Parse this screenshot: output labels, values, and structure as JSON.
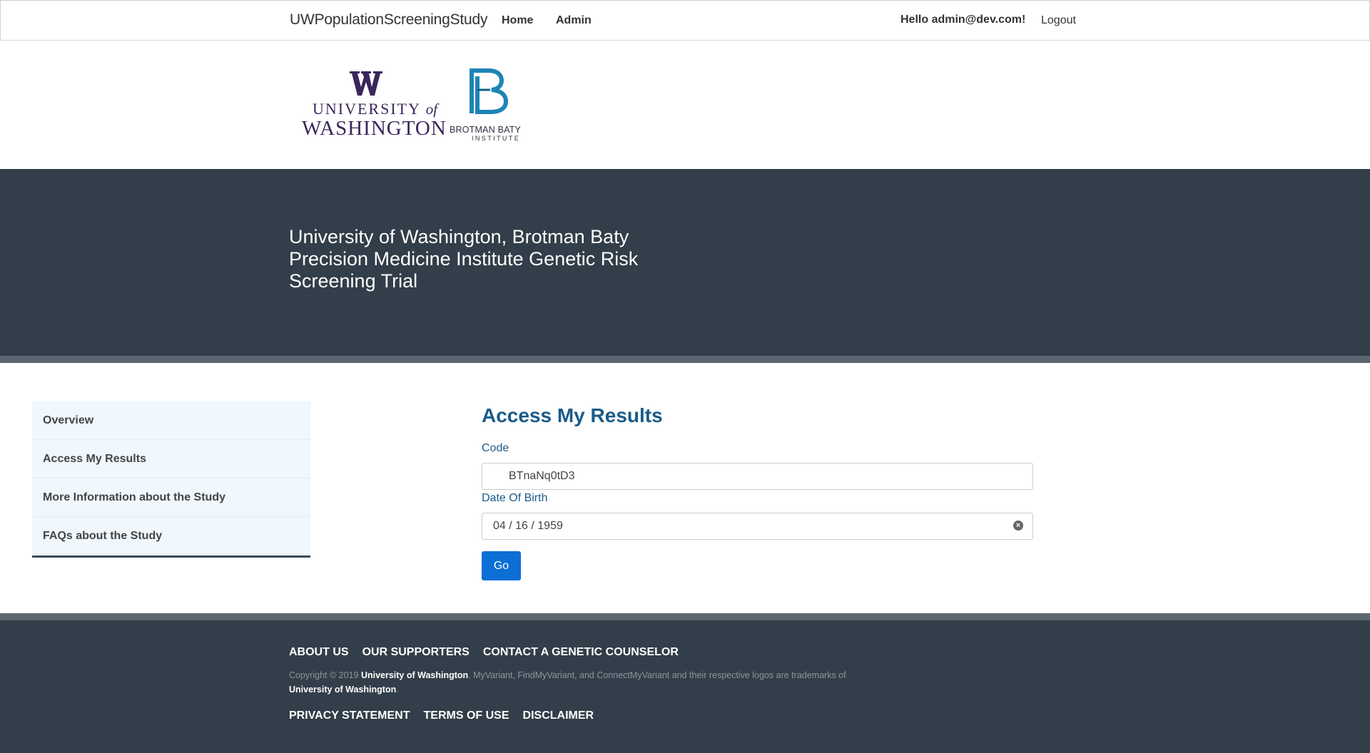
{
  "nav": {
    "brand": "UWPopulationScreeningStudy",
    "home": "Home",
    "admin": "Admin",
    "greeting": "Hello admin@dev.com!",
    "logout": "Logout"
  },
  "logos": {
    "uw_line1_a": "UNIVERSITY ",
    "uw_line1_b": "of",
    "uw_line2": "WASHINGTON",
    "bbi_line1": "BROTMAN BATY",
    "bbi_line2": "INSTITUTE"
  },
  "hero": {
    "title": "University of Washington, Brotman Baty Precision Medicine Institute Genetic Risk Screening Trial"
  },
  "sidebar": {
    "items": [
      {
        "label": "Overview"
      },
      {
        "label": "Access My Results"
      },
      {
        "label": "More Information about the Study"
      },
      {
        "label": "FAQs about the Study"
      }
    ]
  },
  "form": {
    "title": "Access My Results",
    "code_label": "Code",
    "code_value": "BTnaNq0tD3",
    "dob_label": "Date Of Birth",
    "dob_value": "04 / 16 / 1959",
    "go_label": "Go"
  },
  "footer": {
    "links_top": [
      "ABOUT US",
      "OUR SUPPORTERS",
      "CONTACT A GENETIC COUNSELOR"
    ],
    "copyright_prefix": "Copyright © 2019 ",
    "copyright_org1": "University of Washington",
    "copyright_middle": ". MyVariant, FindMyVariant, and ConnectMyVariant and their respective logos are trademarks of ",
    "copyright_org2": "University of Washington",
    "copyright_suffix": ".",
    "links_bottom": [
      "PRIVACY STATEMENT",
      "TERMS OF USE",
      "DISCLAIMER"
    ]
  },
  "colors": {
    "hero_bg": "#323e49",
    "accent": "#1a5b8a",
    "button": "#0b6fd6",
    "uw_purple": "#39275b",
    "bbi_blue": "#1d84b5"
  }
}
